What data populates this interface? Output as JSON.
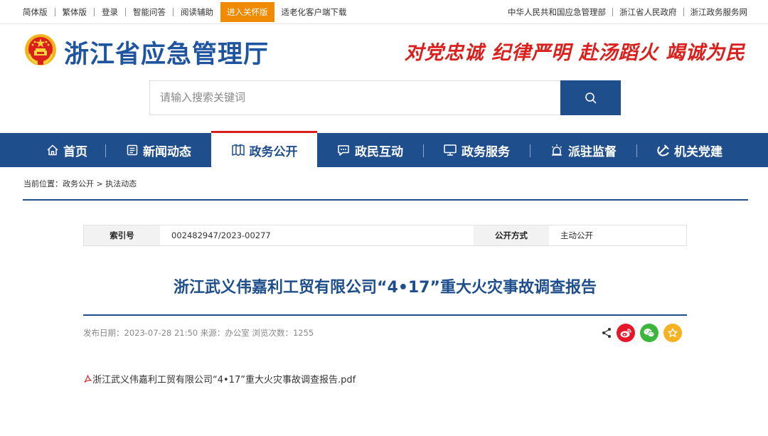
{
  "topbar": {
    "left_links": [
      "简体版",
      "繁体版",
      "登录",
      "智能问答",
      "阅读辅助",
      "进入关怀版",
      "适老化客户端下载"
    ],
    "right_links": [
      "中华人民共和国应急管理部",
      "浙江省人民政府",
      "浙江政务服务网"
    ]
  },
  "header": {
    "site_title": "浙江省应急管理厅",
    "slogan": "对党忠诚 纪律严明 赴汤蹈火 竭诚为民"
  },
  "search": {
    "placeholder": "请输入搜索关键词"
  },
  "nav": {
    "items": [
      {
        "label": "首页",
        "icon": "home-icon"
      },
      {
        "label": "新闻动态",
        "icon": "news-icon"
      },
      {
        "label": "政务公开",
        "icon": "book-icon",
        "active": true
      },
      {
        "label": "政民互动",
        "icon": "chat-icon"
      },
      {
        "label": "政务服务",
        "icon": "monitor-icon"
      },
      {
        "label": "派驻监督",
        "icon": "alarm-icon"
      },
      {
        "label": "机关党建",
        "icon": "party-icon"
      }
    ]
  },
  "breadcrumb": {
    "prefix": "当前位置：",
    "items": [
      "政务公开",
      "执法动态"
    ],
    "separator": " > "
  },
  "meta": {
    "index_label": "索引号",
    "index_value": "002482947/2023-00277",
    "mode_label": "公开方式",
    "mode_value": "主动公开"
  },
  "article": {
    "title": "浙江武义伟嘉利工贸有限公司“4•17”重大火灾事故调查报告",
    "info": "发布日期：2023-07-28 21:50   来源：办公室   浏览次数：1255",
    "attachment": "浙江武义伟嘉利工贸有限公司“4•17”重大火灾事故调查报告.pdf"
  },
  "colors": {
    "brand_blue": "#1f4e8c",
    "title_blue": "#1f55a0",
    "slogan_red": "#d9201c",
    "care_orange": "#f08a00",
    "weibo_red": "#e6162d",
    "wechat_green": "#3bb53b",
    "favorite_yellow": "#f5b324"
  }
}
